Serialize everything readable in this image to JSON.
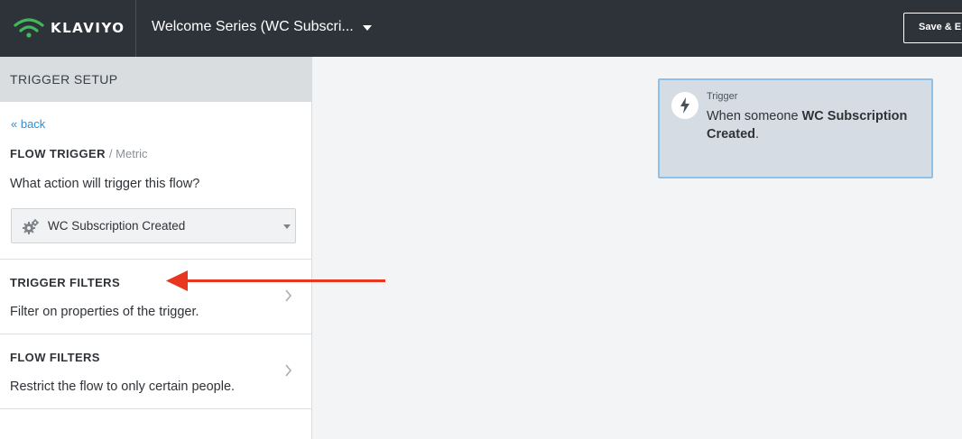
{
  "header": {
    "logo_text": "KLAVIYO",
    "flow_title": "Welcome Series (WC Subscri...",
    "save_label": "Save & E"
  },
  "sidebar": {
    "heading": "TRIGGER SETUP",
    "back_link": "« back",
    "flow_trigger": {
      "title": "FLOW TRIGGER",
      "subtitle": "/ Metric",
      "question": "What action will trigger this flow?",
      "selected_metric": "WC Subscription Created"
    },
    "trigger_filters": {
      "title": "TRIGGER FILTERS",
      "description": "Filter on properties of the trigger."
    },
    "flow_filters": {
      "title": "FLOW FILTERS",
      "description": "Restrict the flow to only certain people."
    }
  },
  "canvas": {
    "trigger_card": {
      "label": "Trigger",
      "text_prefix": "When someone ",
      "metric_bold": "WC Subscription Created",
      "text_suffix": "."
    }
  },
  "colors": {
    "topbar": "#2e3339",
    "link": "#2f8fd3",
    "logo_green": "#3fba5b",
    "annotation_arrow": "#e8361f",
    "card_border": "#8fc0e8"
  },
  "icons": [
    "klaviyo-logo-icon",
    "chevron-down-icon",
    "gear-icon",
    "chevron-right-icon",
    "lightning-bolt-icon",
    "annotation-arrow"
  ]
}
